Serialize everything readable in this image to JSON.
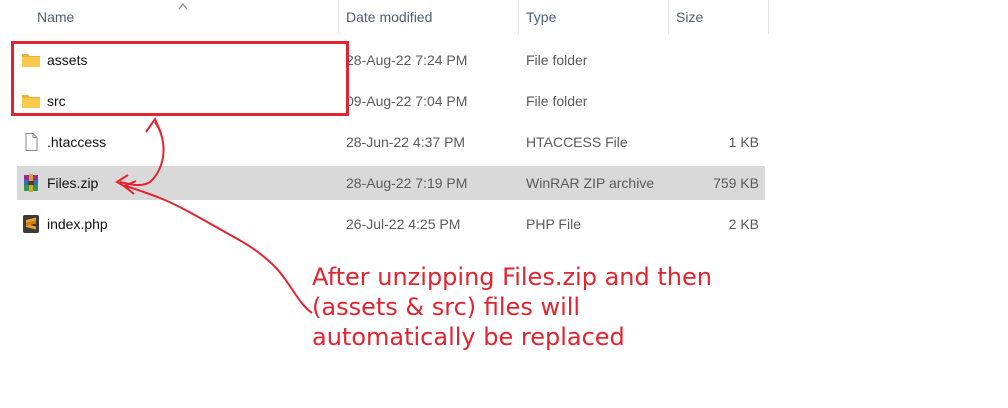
{
  "columns": {
    "name": "Name",
    "date_modified": "Date modified",
    "type": "Type",
    "size": "Size"
  },
  "files": [
    {
      "name": "assets",
      "date": "28-Aug-22 7:24 PM",
      "type": "File folder",
      "size": "",
      "icon": "folder-icon"
    },
    {
      "name": "src",
      "date": "09-Aug-22 7:04 PM",
      "type": "File folder",
      "size": "",
      "icon": "folder-icon"
    },
    {
      "name": ".htaccess",
      "date": "28-Jun-22 4:37 PM",
      "type": "HTACCESS File",
      "size": "1 KB",
      "icon": "blank-file-icon"
    },
    {
      "name": "Files.zip",
      "date": "28-Aug-22 7:19 PM",
      "type": "WinRAR ZIP archive",
      "size": "759 KB",
      "icon": "winrar-archive-icon"
    },
    {
      "name": "index.php",
      "date": "26-Jul-22 4:25 PM",
      "type": "PHP File",
      "size": "2 KB",
      "icon": "sublime-text-icon"
    }
  ],
  "selected_file": "Files.zip",
  "annotation": {
    "lines": [
      "After unzipping Files.zip and then",
      "(assets & src) files will",
      "automatically be replaced"
    ],
    "color": "#e3232f"
  },
  "colors": {
    "header_text": "#4c607a",
    "selected_row": "#d9d9d9",
    "folder": "#f8c94a",
    "annotation_red": "#e3232f"
  }
}
